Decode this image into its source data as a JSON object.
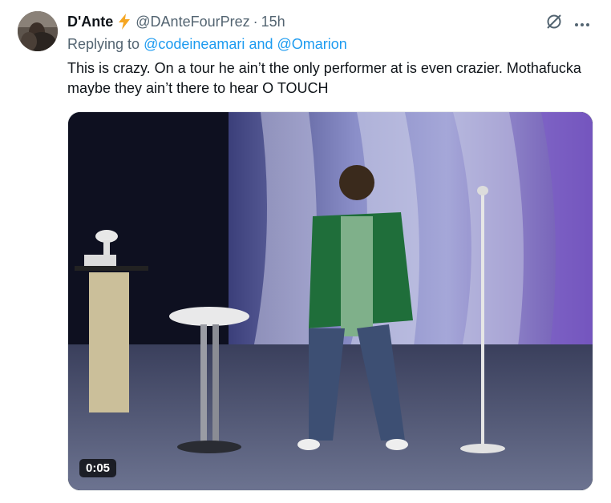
{
  "tweet": {
    "author_name": "D'Ante",
    "author_handle": "@DAnteFourPrez",
    "separator": "·",
    "time": "15h",
    "replying_prefix": "Replying to",
    "mention_1": "@codeineamari",
    "mention_join": "and",
    "mention_2": "@Omarion",
    "text": "This is crazy. On a tour he ain’t the only performer at is even crazier. Mothafucka maybe they ain’t there to hear O TOUCH",
    "video_duration": "0:05"
  },
  "icons": {
    "verified_badge": "lightning-bolt-icon",
    "grok": "grok-slash-circle-icon",
    "more": "more-dots-icon"
  },
  "colors": {
    "accent": "#1d9bf0",
    "bolt": "#f5a623",
    "secondary_text": "#536471"
  }
}
